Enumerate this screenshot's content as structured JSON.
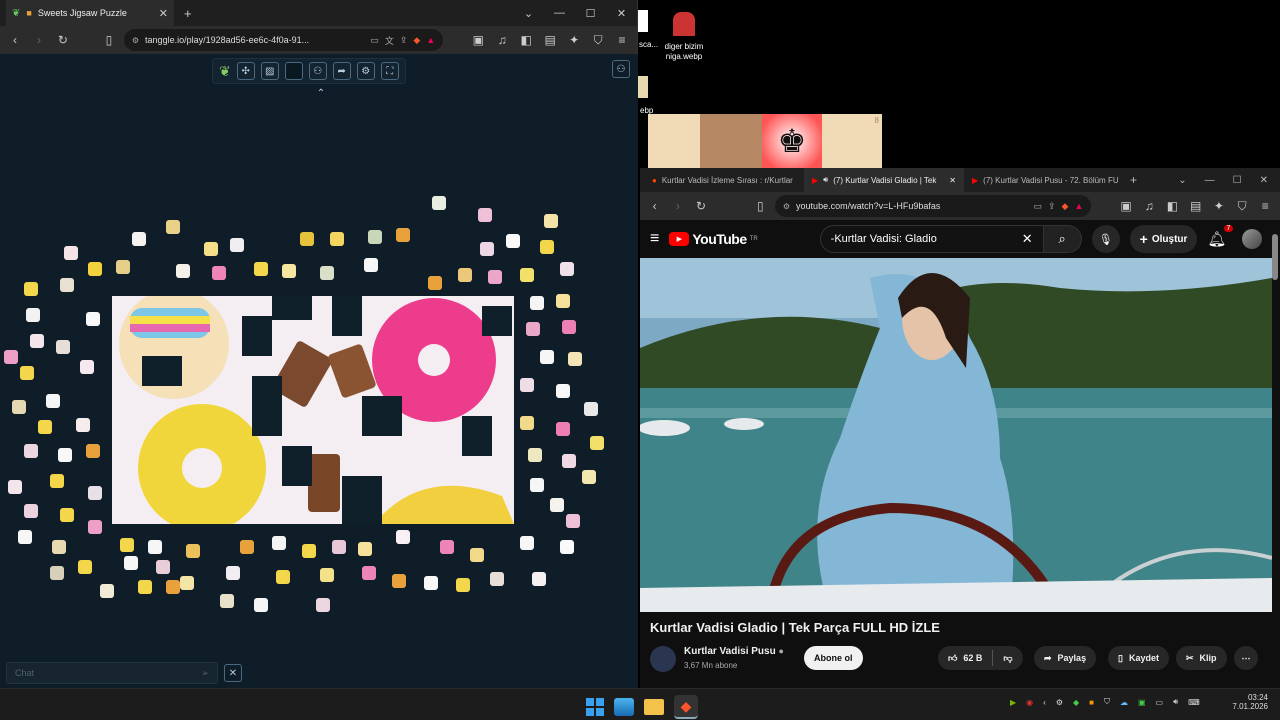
{
  "left_window": {
    "tab_title": "Sweets Jigsaw Puzzle",
    "url": "tanggle.io/play/1928ad56-ee6c-4f0a-91...",
    "chat_placeholder": "Chat"
  },
  "desktop": {
    "icon_partial_label": "sca...",
    "icon_file_label_line1": "diger bizim",
    "icon_file_label_line2": "niga.webp",
    "partial_label_2": "ebp",
    "chess_badge": "8"
  },
  "right_window": {
    "tabs": [
      {
        "label": "Kurtlar Vadisi İzleme Sırası : r/Kurtlar"
      },
      {
        "label": "(7) Kurtlar Vadisi Gladio | Tek"
      },
      {
        "label": "(7) Kurtlar Vadisi Pusu - 72. Bölüm FU"
      }
    ],
    "url": "youtube.com/watch?v=L-HFu9bafas",
    "youtube": {
      "logo_text": "YouTube",
      "logo_sup": "TR",
      "search_value": "-Kurtlar Vadisi: Gladio",
      "create_label": "Oluştur",
      "notification_count": "7",
      "video_title": "Kurtlar Vadisi Gladio | Tek Parça FULL HD İZLE",
      "channel_name": "Kurtlar Vadisi Pusu",
      "subscribers": "3,67 Mn abone",
      "subscribe_label": "Abone ol",
      "like_count": "62 B",
      "share_label": "Paylaş",
      "save_label": "Kaydet",
      "clip_label": "Klip"
    }
  },
  "taskbar": {
    "time": "03:24",
    "date": "7.01.2026"
  },
  "colors": {
    "puzzle_bg": "#0f1d28",
    "yt_red": "#ff0000",
    "browser_chrome": "#2c2c2c"
  }
}
